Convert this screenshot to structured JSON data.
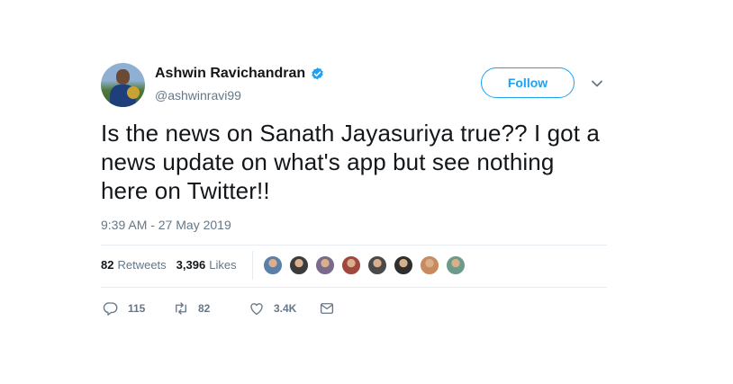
{
  "user": {
    "name": "Ashwin Ravichandran",
    "handle": "@ashwinravi99",
    "verified": true
  },
  "follow_button": {
    "label": "Follow"
  },
  "tweet": {
    "text": "Is the news on Sanath Jayasuriya true?? I got a news update on what's app but see nothing here on Twitter!!",
    "timestamp": "9:39 AM - 27 May 2019"
  },
  "stats": {
    "retweets_count": "82",
    "retweets_label": "Retweets",
    "likes_count": "3,396",
    "likes_label": "Likes"
  },
  "likers": [
    {
      "color": "#5a7fa8"
    },
    {
      "color": "#3b3b3b"
    },
    {
      "color": "#7a6a8c"
    },
    {
      "color": "#a0473f"
    },
    {
      "color": "#4a4a4a"
    },
    {
      "color": "#2f2f2f"
    },
    {
      "color": "#c98a5e"
    },
    {
      "color": "#6c9a8b"
    }
  ],
  "actions": {
    "reply_count": "115",
    "retweet_count": "82",
    "like_count": "3.4K"
  },
  "colors": {
    "accent": "#1da1f2",
    "text": "#14171a",
    "muted": "#657786",
    "divider": "#e6ecf0"
  },
  "icons": [
    "verified-badge-icon",
    "chevron-down-icon",
    "reply-icon",
    "retweet-icon",
    "heart-icon",
    "direct-message-icon"
  ]
}
